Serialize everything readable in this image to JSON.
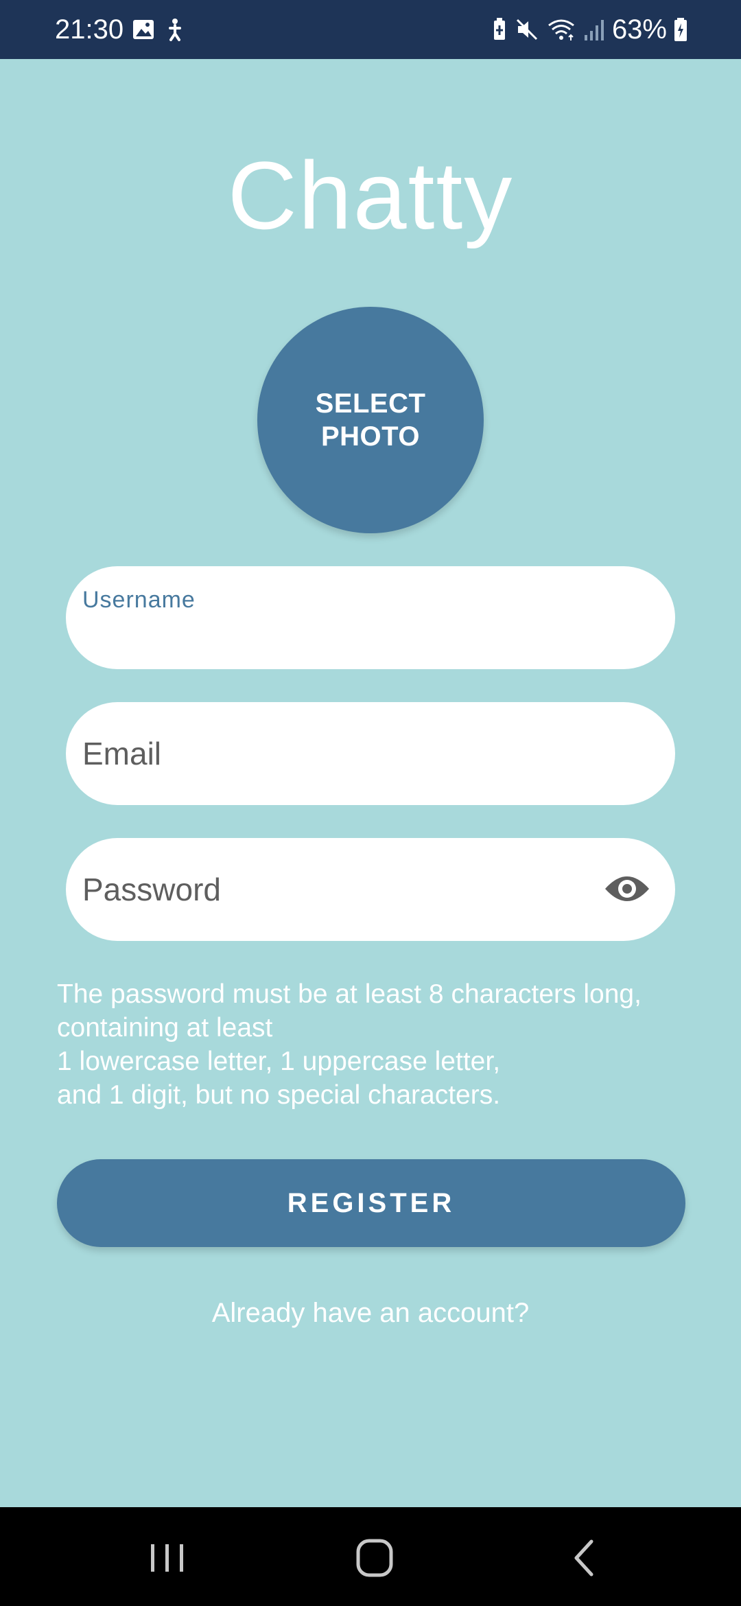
{
  "status_bar": {
    "time": "21:30",
    "battery": "63%",
    "left_icons": [
      "image-icon",
      "accessibility-icon"
    ],
    "right_icons": [
      "battery-saver-icon",
      "mute-icon",
      "wifi-icon",
      "signal-icon",
      "battery-icon"
    ]
  },
  "app": {
    "title": "Chatty"
  },
  "photo": {
    "label": "SELECT PHOTO"
  },
  "form": {
    "username_label": "Username",
    "email_placeholder": "Email",
    "password_placeholder": "Password",
    "password_hint_lines": [
      "The password must be at least 8 characters long,",
      "containing at least",
      "1 lowercase letter, 1 uppercase letter,",
      "and 1 digit, but no special characters."
    ],
    "register_label": "REGISTER",
    "login_link": "Already have an account?"
  },
  "nav_bar": {
    "buttons": [
      "recents-icon",
      "home-icon",
      "back-icon"
    ]
  },
  "colors": {
    "background": "#a8d9db",
    "status_bar": "#1e3457",
    "accent": "#47799e",
    "field_bg": "#ffffff",
    "text_light": "#ffffff"
  }
}
